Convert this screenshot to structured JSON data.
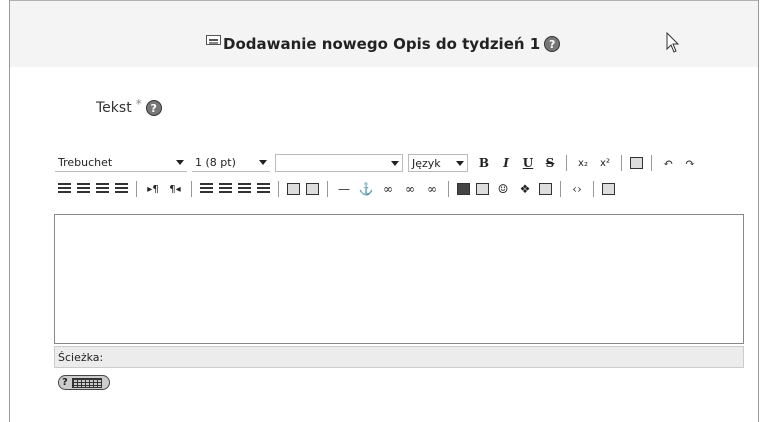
{
  "form": {
    "title": "Dodawanie nowego Opis do tydzień 1",
    "help_symbol": "?"
  },
  "field": {
    "label": "Tekst",
    "required_marker": "*",
    "help_symbol": "?"
  },
  "toolbar": {
    "font_family": "Trebuchet",
    "font_size": "1 (8 pt)",
    "style_value": "",
    "language": "Język",
    "bold": "B",
    "italic": "I",
    "underline": "U",
    "strike": "S",
    "subscript": "x₂",
    "superscript": "x²",
    "icons_row1": [
      "paste-word-icon",
      "undo-icon",
      "redo-icon"
    ],
    "icons_row2": [
      "align-left-icon",
      "align-center-icon",
      "align-right-icon",
      "justify-icon",
      "ltr-icon",
      "rtl-icon",
      "numbered-list-icon",
      "bullet-list-icon",
      "outdent-icon",
      "indent-icon",
      "text-color-icon",
      "bg-color-icon",
      "hr-icon",
      "anchor-icon",
      "link-icon",
      "unlink-icon",
      "nolink-icon",
      "image-icon",
      "table-icon",
      "smiley-icon",
      "emoticon-icon",
      "search-replace-icon",
      "html-icon",
      "fullscreen-icon"
    ]
  },
  "status": {
    "path_label": "Ścieżka:"
  },
  "keyboard_button": {
    "help_symbol": "?"
  }
}
